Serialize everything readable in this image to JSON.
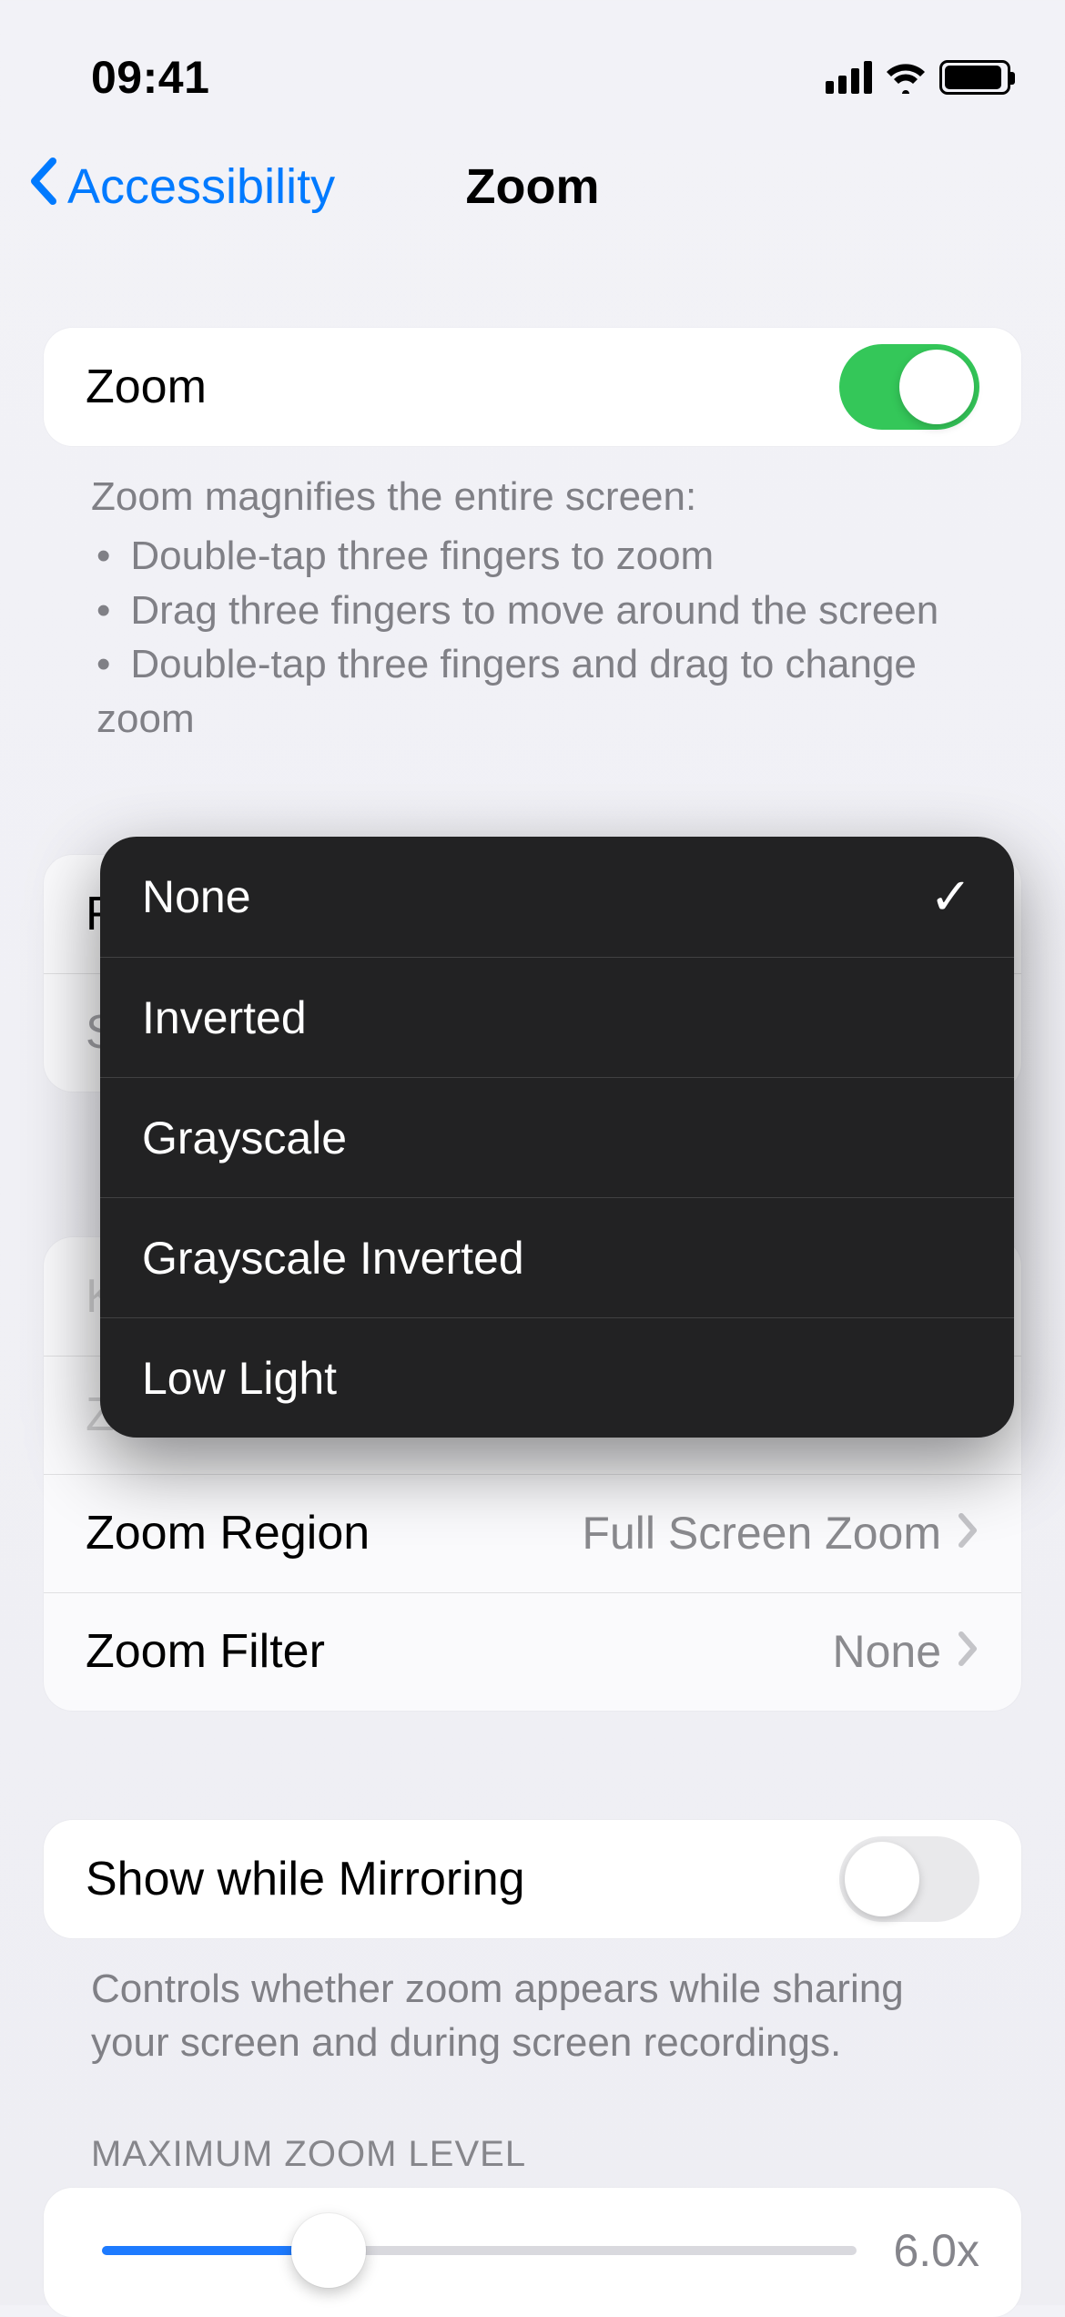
{
  "status": {
    "time": "09:41"
  },
  "nav": {
    "back": "Accessibility",
    "title": "Zoom"
  },
  "zoom_toggle": {
    "label": "Zoom",
    "on": true
  },
  "zoom_help": {
    "lead": "Zoom magnifies the entire screen:",
    "bullets": [
      "Double-tap three fingers to zoom",
      "Drag three fingers to move around the screen",
      "Double-tap three fingers and drag to change zoom"
    ]
  },
  "follow_focus": {
    "label": "Follow Focus",
    "on": true
  },
  "smart_typing_behind": "S",
  "keyboard_shortcuts_behind": "K",
  "zoom_controller_behind": "Z",
  "zoom_region": {
    "label": "Zoom Region",
    "value": "Full Screen Zoom"
  },
  "zoom_filter": {
    "label": "Zoom Filter",
    "value": "None"
  },
  "mirroring": {
    "label": "Show while Mirroring",
    "help": "Controls whether zoom appears while sharing your screen and during screen recordings.",
    "on": false
  },
  "max_zoom": {
    "header": "MAXIMUM ZOOM LEVEL",
    "value": "6.0x"
  },
  "filter_menu": {
    "options": [
      "None",
      "Inverted",
      "Grayscale",
      "Grayscale Inverted",
      "Low Light"
    ],
    "selected": "None"
  }
}
